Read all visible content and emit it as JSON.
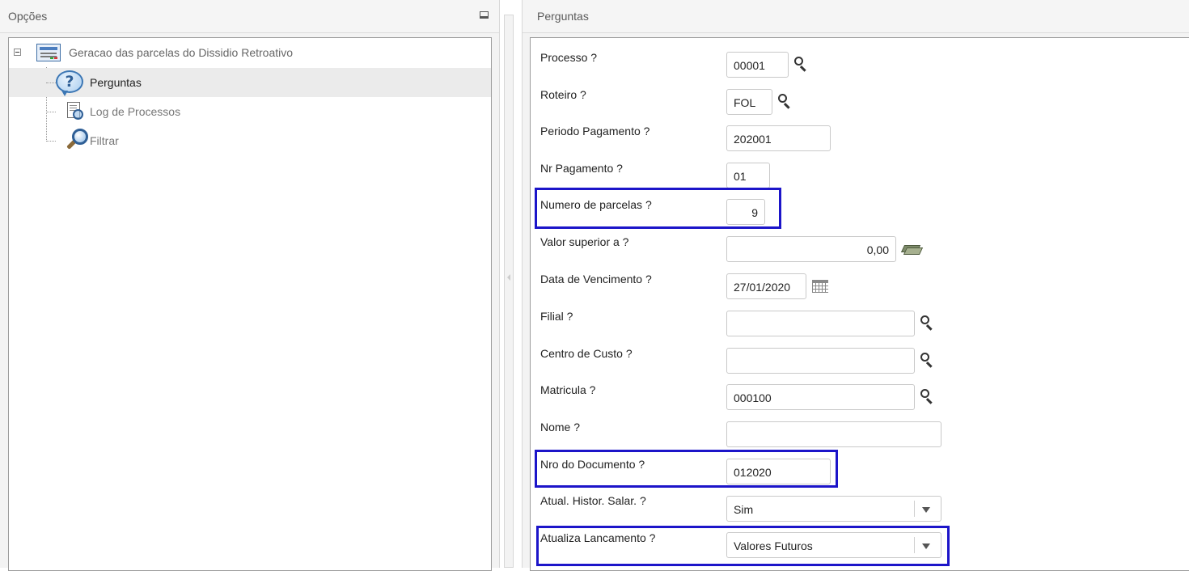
{
  "left_panel": {
    "title": "Opções",
    "tree": {
      "root_label": "Geracao das parcelas do Dissidio Retroativo",
      "items": [
        {
          "label": "Perguntas",
          "icon": "question-icon",
          "selected": true
        },
        {
          "label": "Log de Processos",
          "icon": "log-icon",
          "selected": false
        },
        {
          "label": "Filtrar",
          "icon": "magnifier-icon",
          "selected": false
        }
      ]
    }
  },
  "right_panel": {
    "title": "Perguntas",
    "questions": [
      {
        "label": "Processo ?",
        "value": "00001",
        "type": "lookup"
      },
      {
        "label": "Roteiro ?",
        "value": "FOL",
        "type": "lookup"
      },
      {
        "label": "Periodo Pagamento ?",
        "value": "202001",
        "type": "text"
      },
      {
        "label": "Nr Pagamento ?",
        "value": "01",
        "type": "text"
      },
      {
        "label": "Numero de parcelas ?",
        "value": "9",
        "type": "number"
      },
      {
        "label": "Valor superior a ?",
        "value": "0,00",
        "type": "currency"
      },
      {
        "label": "Data de Vencimento ?",
        "value": "27/01/2020",
        "type": "date"
      },
      {
        "label": "Filial ?",
        "value": "",
        "type": "lookup"
      },
      {
        "label": "Centro de Custo ?",
        "value": "",
        "type": "lookup"
      },
      {
        "label": "Matricula ?",
        "value": "000100",
        "type": "lookup"
      },
      {
        "label": "Nome ?",
        "value": "",
        "type": "text"
      },
      {
        "label": "Nro do Documento ?",
        "value": "012020",
        "type": "text"
      },
      {
        "label": "Atual. Histor. Salar. ?",
        "value": "Sim",
        "type": "select"
      },
      {
        "label": "Atualiza Lancamento ?",
        "value": "Valores Futuros",
        "type": "select"
      }
    ]
  },
  "colors": {
    "highlight_border": "#1c15c9",
    "panel_background": "#f3f3f3",
    "selected_row": "#ebebeb"
  }
}
